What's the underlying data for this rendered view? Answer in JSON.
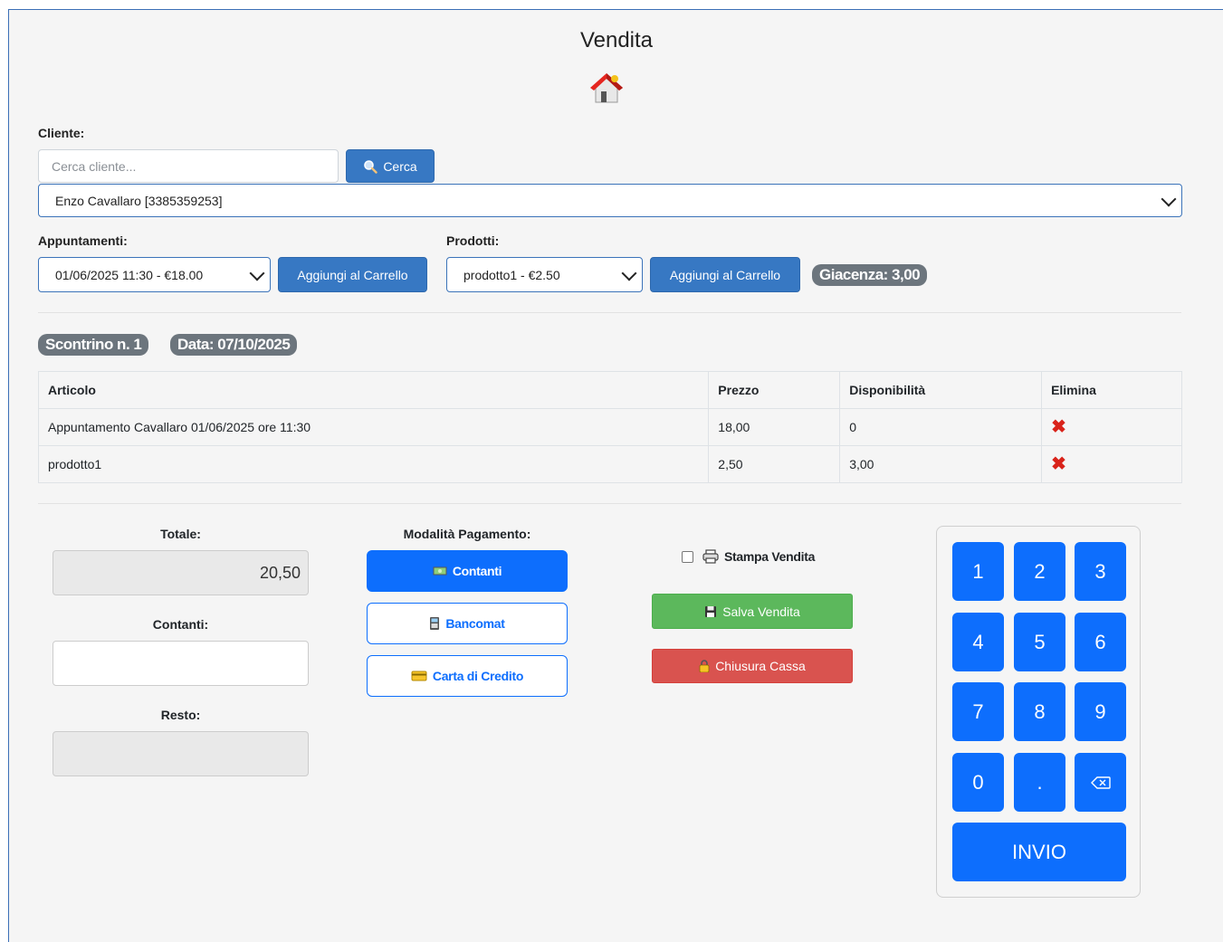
{
  "page": {
    "title": "Vendita",
    "home_icon": "home-icon"
  },
  "cliente": {
    "label": "Cliente:",
    "search_placeholder": "Cerca cliente...",
    "search_value": "",
    "search_button": "Cerca",
    "selected": "Enzo Cavallaro [3385359253]"
  },
  "appuntamenti": {
    "label": "Appuntamenti:",
    "selected": "01/06/2025 11:30 - €18.00",
    "add_button": "Aggiungi al Carrello"
  },
  "prodotti": {
    "label": "Prodotti:",
    "selected": "prodotto1 - €2.50",
    "add_button": "Aggiungi al Carrello",
    "stock_badge": "Giacenza: 3,00"
  },
  "receipt": {
    "number_badge": "Scontrino n. 1",
    "date_badge": "Data: 07/10/2025"
  },
  "table": {
    "headers": [
      "Articolo",
      "Prezzo",
      "Disponibilità",
      "Elimina"
    ],
    "rows": [
      {
        "articolo": "Appuntamento Cavallaro 01/06/2025 ore 11:30",
        "prezzo": "18,00",
        "disponibilita": "0",
        "elimina": "✖"
      },
      {
        "articolo": "prodotto1",
        "prezzo": "2,50",
        "disponibilita": "3,00",
        "elimina": "✖"
      }
    ]
  },
  "totals": {
    "totale_label": "Totale:",
    "totale_value": "20,50",
    "contanti_label": "Contanti:",
    "contanti_value": "",
    "resto_label": "Resto:",
    "resto_value": ""
  },
  "payment": {
    "label": "Modalità Pagamento:",
    "contanti": "Contanti",
    "bancomat": "Bancomat",
    "carta": "Carta di Credito"
  },
  "actions": {
    "stampa_label": "Stampa Vendita",
    "stampa_checked": false,
    "salva": "Salva Vendita",
    "chiusura": "Chiusura Cassa"
  },
  "keypad": {
    "keys": [
      "1",
      "2",
      "3",
      "4",
      "5",
      "6",
      "7",
      "8",
      "9",
      "0",
      "."
    ],
    "backspace_icon": "backspace-icon",
    "enter": "INVIO"
  },
  "colors": {
    "primary": "#0d6efd",
    "header_button": "#3778c3",
    "success": "#5cb85c",
    "danger": "#d9534f",
    "badge": "#6c757d"
  }
}
